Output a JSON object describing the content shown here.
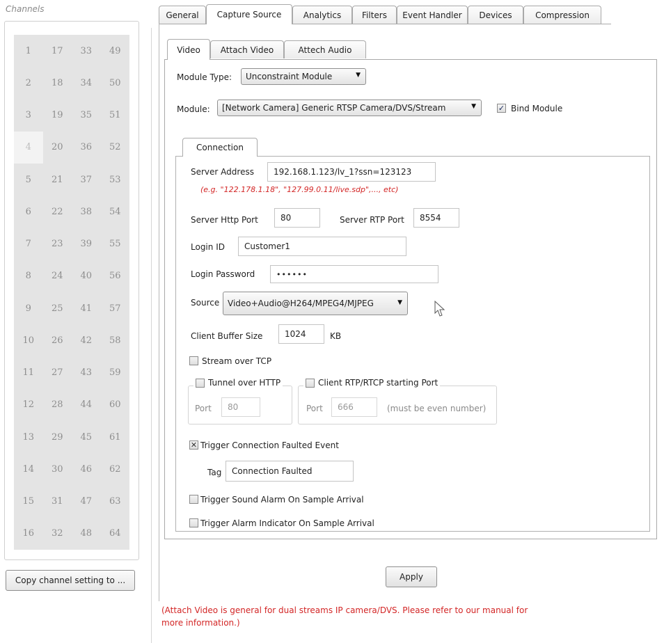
{
  "channels": {
    "caption": "Channels",
    "columns": [
      [
        "1",
        "2",
        "3",
        "4",
        "5",
        "6",
        "7",
        "8",
        "9",
        "10",
        "11",
        "12",
        "13",
        "14",
        "15",
        "16"
      ],
      [
        "17",
        "18",
        "19",
        "20",
        "21",
        "22",
        "23",
        "24",
        "25",
        "26",
        "27",
        "28",
        "29",
        "30",
        "31",
        "32"
      ],
      [
        "33",
        "34",
        "35",
        "36",
        "37",
        "38",
        "39",
        "40",
        "41",
        "42",
        "43",
        "44",
        "45",
        "46",
        "47",
        "48"
      ],
      [
        "49",
        "50",
        "51",
        "52",
        "53",
        "54",
        "55",
        "56",
        "57",
        "58",
        "59",
        "60",
        "61",
        "62",
        "63",
        "64"
      ]
    ],
    "selected": "4",
    "copy_button": "Copy channel setting to ..."
  },
  "tabs": [
    "General",
    "Capture Source",
    "Analytics",
    "Filters",
    "Event Handler",
    "Devices",
    "Compression"
  ],
  "active_tab": "Capture Source",
  "subtabs": [
    "Video",
    "Attach Video",
    "Attech Audio"
  ],
  "active_subtab": "Video",
  "module_type": {
    "label": "Module Type:",
    "value": "Unconstraint Module"
  },
  "module": {
    "label": "Module:",
    "value": "[Network Camera] Generic RTSP Camera/DVS/Stream",
    "bind_label": "Bind Module",
    "bind_checked": true
  },
  "connection": {
    "tab": "Connection",
    "server_address": {
      "label": "Server Address",
      "value": "192.168.1.123/lv_1?ssn=123123",
      "hint": "(e.g. \"122.178.1.18\", \"127.99.0.11/live.sdp\",..., etc)"
    },
    "http_port": {
      "label": "Server Http Port",
      "value": "80"
    },
    "rtp_port": {
      "label": "Server RTP Port",
      "value": "8554"
    },
    "login_id": {
      "label": "Login ID",
      "value": "Customer1"
    },
    "login_password": {
      "label": "Login Password",
      "value": "••••••"
    },
    "source": {
      "label": "Source",
      "value": "Video+Audio@H264/MPEG4/MJPEG"
    },
    "buffer": {
      "label": "Client Buffer Size",
      "value": "1024",
      "unit": "KB"
    },
    "stream_tcp": {
      "label": "Stream over TCP",
      "checked": false
    },
    "tunnel_http": {
      "label": "Tunnel over HTTP",
      "checked": false,
      "port_label": "Port",
      "port_value": "80"
    },
    "client_rtp": {
      "label": "Client RTP/RTCP starting Port",
      "checked": false,
      "port_label": "Port",
      "port_value": "666",
      "port_note": "(must be even number)"
    },
    "trigger_faulted": {
      "label": "Trigger Connection Faulted Event",
      "checked": true
    },
    "tag": {
      "label": "Tag",
      "value": "Connection Faulted"
    },
    "trigger_sound": {
      "label": "Trigger Sound Alarm On Sample Arrival",
      "checked": false
    },
    "trigger_indicator": {
      "label": "Trigger Alarm Indicator On Sample Arrival",
      "checked": false
    }
  },
  "apply_button": "Apply",
  "note": "(Attach Video is general for dual streams IP camera/DVS. Please refer to our manual for more information.)"
}
